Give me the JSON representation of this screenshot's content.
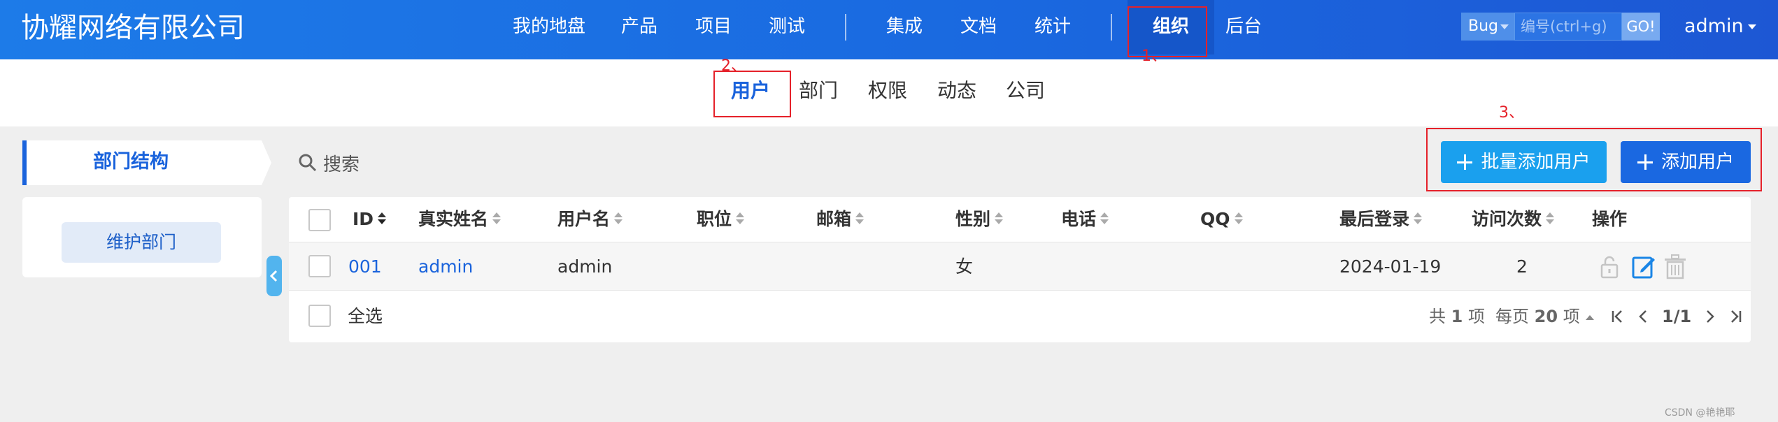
{
  "header": {
    "brand": "协耀网络有限公司",
    "nav": [
      "我的地盘",
      "产品",
      "项目",
      "测试",
      "集成",
      "文档",
      "统计",
      "组织",
      "后台"
    ],
    "active_nav": "组织",
    "search": {
      "type": "Bug",
      "placeholder": "编号(ctrl+g)",
      "go": "GO!"
    },
    "user": "admin"
  },
  "subnav": {
    "items": [
      "用户",
      "部门",
      "权限",
      "动态",
      "公司"
    ],
    "active": "用户"
  },
  "annotations": {
    "one": "1、",
    "two": "2、",
    "three": "3、"
  },
  "sidebar": {
    "title": "部门结构",
    "maintain_button": "维护部门"
  },
  "toolbar": {
    "search_label": "搜索",
    "batch_add": "批量添加用户",
    "add": "添加用户"
  },
  "table": {
    "columns": [
      "ID",
      "真实姓名",
      "用户名",
      "职位",
      "邮箱",
      "性别",
      "电话",
      "QQ",
      "最后登录",
      "访问次数",
      "操作"
    ],
    "rows": [
      {
        "id": "001",
        "realname": "admin",
        "username": "admin",
        "position": "",
        "email": "",
        "gender": "女",
        "phone": "",
        "qq": "",
        "last_login": "2024-01-19",
        "visits": "2"
      }
    ],
    "select_all": "全选"
  },
  "pager": {
    "total_prefix": "共",
    "total": "1",
    "total_suffix": "项",
    "per_page_prefix": "每页",
    "per_page": "20",
    "per_page_suffix": "项",
    "page": "1/1"
  },
  "watermark": "CSDN @艳艳耶",
  "colors": {
    "header_start": "#1d7be8",
    "header_end": "#1d57d4",
    "accent": "#1a63dc",
    "annotation": "#e5212a",
    "batch_button": "#1aa0ee",
    "add_button": "#1a68e1"
  }
}
